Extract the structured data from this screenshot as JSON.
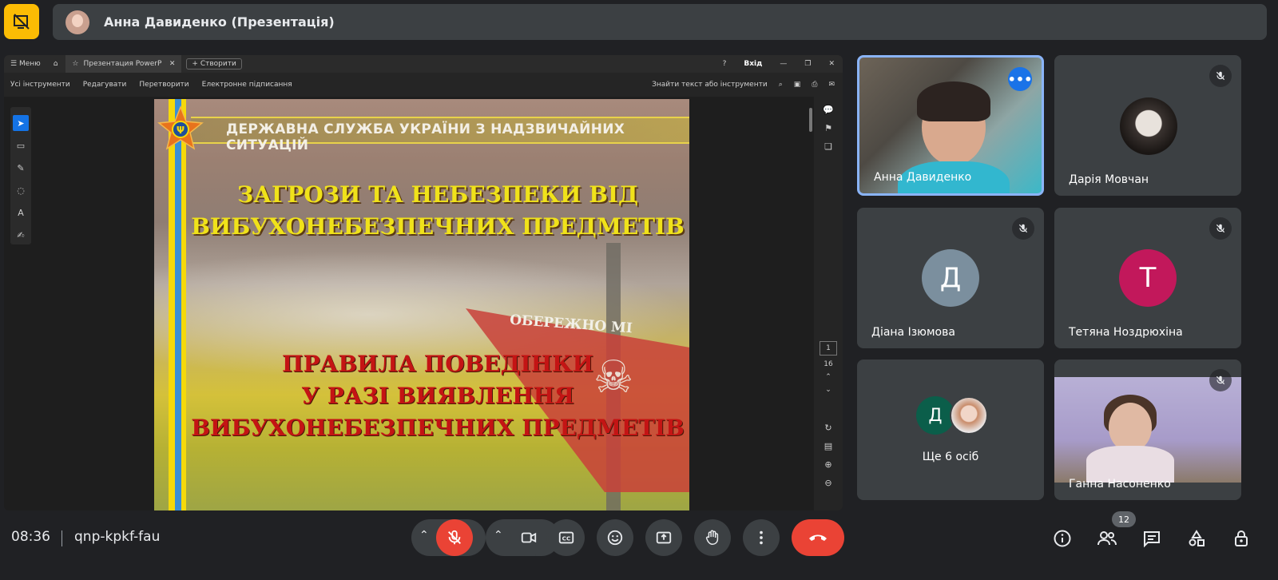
{
  "top": {
    "presenter_label": "Анна Давиденко (Презентація)"
  },
  "viewer": {
    "tabs": {
      "menu": "Меню",
      "active_tab": "Презентация PowerP",
      "new_tab": "Створити",
      "signin": "Вхід"
    },
    "toolbar": {
      "all_tools": "Усі інструменти",
      "edit": "Редагувати",
      "convert": "Перетворити",
      "esign": "Електронне підписання",
      "search": "Знайти текст або інструменти"
    },
    "page_current": "1",
    "page_total": "16"
  },
  "slide": {
    "header": "ДЕРЖАВНА СЛУЖБА УКРАЇНИ З НАДЗВИЧАЙНИХ СИТУАЦІЙ",
    "title_line1": "ЗАГРОЗИ ТА НЕБЕЗПЕКИ ВІД",
    "title_line2": "ВИБУХОНЕБЕЗПЕЧНИХ ПРЕДМЕТІВ",
    "sign_text": "ОБЕРЕЖНО МІ",
    "rules_line1": "ПРАВИЛА ПОВЕДІНКИ",
    "rules_line2": "У РАЗІ ВИЯВЛЕННЯ",
    "rules_line3": "ВИБУХОНЕБЕЗПЕЧНИХ ПРЕДМЕТІВ"
  },
  "participants": [
    {
      "name": "Анна Давиденко"
    },
    {
      "name": "Дарія Мовчан"
    },
    {
      "name": "Діана Ізюмова",
      "initial": "Д",
      "color": "#7b8f9e"
    },
    {
      "name": "Тетяна Ноздрюхіна",
      "initial": "Т",
      "color": "#c2185b"
    },
    {
      "name": "Ще 6 осіб",
      "initial": "Д",
      "color": "#0b5e4a"
    },
    {
      "name": "Ганна Насоненко"
    }
  ],
  "bottom": {
    "time": "08:36",
    "meeting_code": "qnp-kpkf-fau",
    "people_count": "12"
  },
  "colors": {
    "accent_blue": "#8ab4f8",
    "end_call": "#ea4335",
    "mic_off": "#ea4335",
    "present_icon": "#fbbc04"
  }
}
